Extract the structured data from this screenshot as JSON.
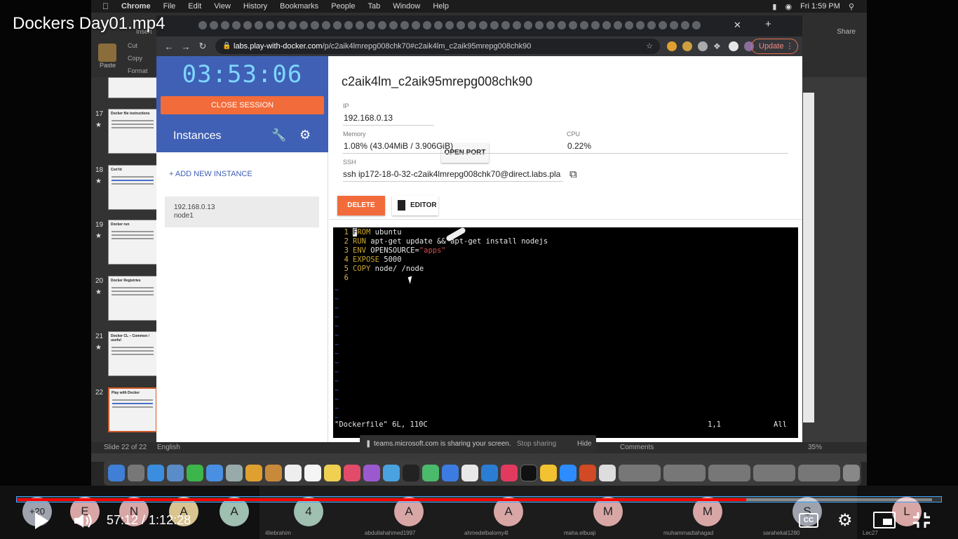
{
  "video": {
    "title": "Dockers Day01.mp4",
    "current_time": "57:12",
    "duration": "1:12:28",
    "time_display": "57:12 / 1:12:28",
    "progress_fraction": 0.789,
    "buffer_fraction": 0.99,
    "cc_label": "CC"
  },
  "mac_menubar": {
    "app": "Chrome",
    "items": [
      "File",
      "Edit",
      "View",
      "History",
      "Bookmarks",
      "People",
      "Tab",
      "Window",
      "Help"
    ],
    "clock": "Fri 1:59 PM"
  },
  "powerpoint": {
    "paste_label": "Paste",
    "cut_label": "Cut",
    "copy_label": "Copy",
    "format_label": "Format",
    "insert_label": "Insert",
    "share_label": "Share",
    "slides": [
      {
        "num": "17",
        "title": "Docker file instructions"
      },
      {
        "num": "18",
        "title": "Con'td"
      },
      {
        "num": "19",
        "title": "Docker run"
      },
      {
        "num": "20",
        "title": "Docker Registries"
      },
      {
        "num": "21",
        "title": "Docker CL – Common / useful"
      },
      {
        "num": "22",
        "title": "Play with Docker"
      }
    ],
    "status_slide": "Slide 22 of 22",
    "status_lang": "English",
    "comments_label": "Comments",
    "zoom": "35%"
  },
  "browser": {
    "url_host": "labs.play-with-docker.com",
    "url_path": "/p/c2aik4lmrepg008chk70#c2aik4lm_c2aik95mrepg008chk90",
    "update_label": "Update"
  },
  "pwd": {
    "timer": "03:53:06",
    "close_session": "CLOSE SESSION",
    "instances_title": "Instances",
    "add_instance": "+ ADD NEW INSTANCE",
    "instance": {
      "ip": "192.168.0.13",
      "name": "node1"
    },
    "instance_header": "c2aik4lm_c2aik95mrepg008chk90",
    "ip_label": "IP",
    "ip_value": "192.168.0.13",
    "open_port": "OPEN PORT",
    "memory_label": "Memory",
    "memory_value": "1.08% (43.04MiB / 3.906GiB)",
    "cpu_label": "CPU",
    "cpu_value": "0.22%",
    "ssh_label": "SSH",
    "ssh_value": "ssh ip172-18-0-32-c2aik4lmrepg008chk70@direct.labs.pla",
    "delete_label": "DELETE",
    "editor_label": "EDITOR"
  },
  "terminal": {
    "lines": [
      {
        "n": "1",
        "kw": "FROM",
        "rest": " ubuntu",
        "str": ""
      },
      {
        "n": "2",
        "kw": "RUN",
        "rest": " apt-get update && apt-get install nodejs",
        "str": ""
      },
      {
        "n": "3",
        "kw": "ENV",
        "rest": " OPENSOURCE=",
        "str": "\"apps\""
      },
      {
        "n": "4",
        "kw": "EXPOSE",
        "rest": " 5000",
        "str": ""
      },
      {
        "n": "5",
        "kw": "COPY",
        "rest": " node/ /node",
        "str": ""
      },
      {
        "n": "6",
        "kw": "",
        "rest": "",
        "str": ""
      }
    ],
    "status_file": "\"Dockerfile\" 6L, 110C",
    "status_pos": "1,1",
    "status_all": "All"
  },
  "teams_bar": {
    "message": "teams.microsoft.com is sharing your screen.",
    "stop": "Stop sharing",
    "hide": "Hide"
  },
  "participants": [
    {
      "initial": "+20",
      "name": "",
      "color": "#9fa3ad"
    },
    {
      "initial": "E",
      "name": "",
      "color": "#d9a6a6"
    },
    {
      "initial": "N",
      "name": "",
      "color": "#d9a6a6"
    },
    {
      "initial": "A",
      "name": "",
      "color": "#d9c48f"
    },
    {
      "initial": "A",
      "name": "4liebrahim",
      "color": "#9fbfb0"
    },
    {
      "initial": "4",
      "name": "abdullahahmed1997",
      "color": "#9fbfb0"
    },
    {
      "initial": "A",
      "name": "ahmedelbalomy4l",
      "color": "#d9a6a6"
    },
    {
      "initial": "A",
      "name": "maha.elbuaji",
      "color": "#d9a6a6"
    },
    {
      "initial": "M",
      "name": "muhammadtahagad",
      "color": "#d9a6a6"
    },
    {
      "initial": "M",
      "name": "sarahekal1280",
      "color": "#d9a6a6"
    },
    {
      "initial": "S",
      "name": "Lec27",
      "color": "#9fa3ad"
    },
    {
      "initial": "L",
      "name": "",
      "color": "#d9a6a6"
    }
  ]
}
